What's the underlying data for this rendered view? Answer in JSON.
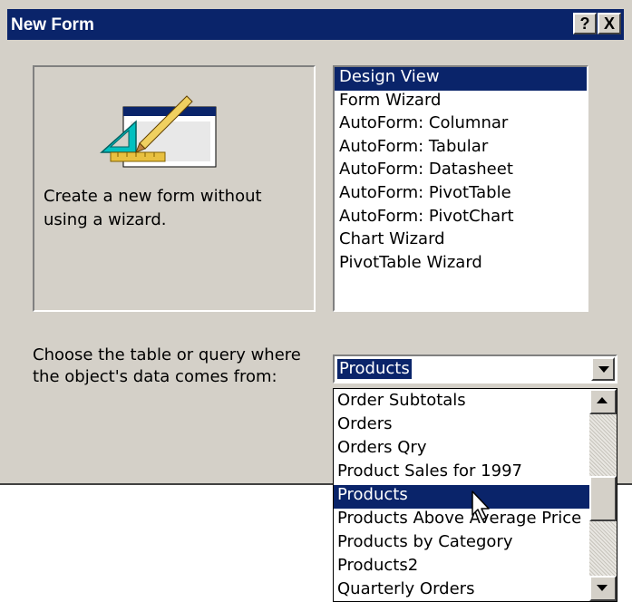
{
  "dialog": {
    "title": "New Form",
    "help_button": "?",
    "close_button": "X"
  },
  "preview": {
    "icon": "form-design-icon",
    "description": "Create a new form without using a wizard."
  },
  "view_list": {
    "items": [
      "Design View",
      "Form Wizard",
      "AutoForm:  Columnar",
      "AutoForm:  Tabular",
      "AutoForm:  Datasheet",
      "AutoForm:  PivotTable",
      "AutoForm:  PivotChart",
      "Chart Wizard",
      "PivotTable Wizard"
    ],
    "selected": "Design View"
  },
  "source": {
    "label": "Choose the table or query where the object's data comes from:",
    "selected_value": "Products",
    "options": [
      "Order Subtotals",
      "Orders",
      "Orders Qry",
      "Product Sales for 1997",
      "Products",
      "Products Above Average Price",
      "Products by Category",
      "Products2",
      "Quarterly Orders"
    ],
    "highlighted": "Products"
  },
  "colors": {
    "selection": "#0a246a",
    "face": "#d4d0c8"
  }
}
